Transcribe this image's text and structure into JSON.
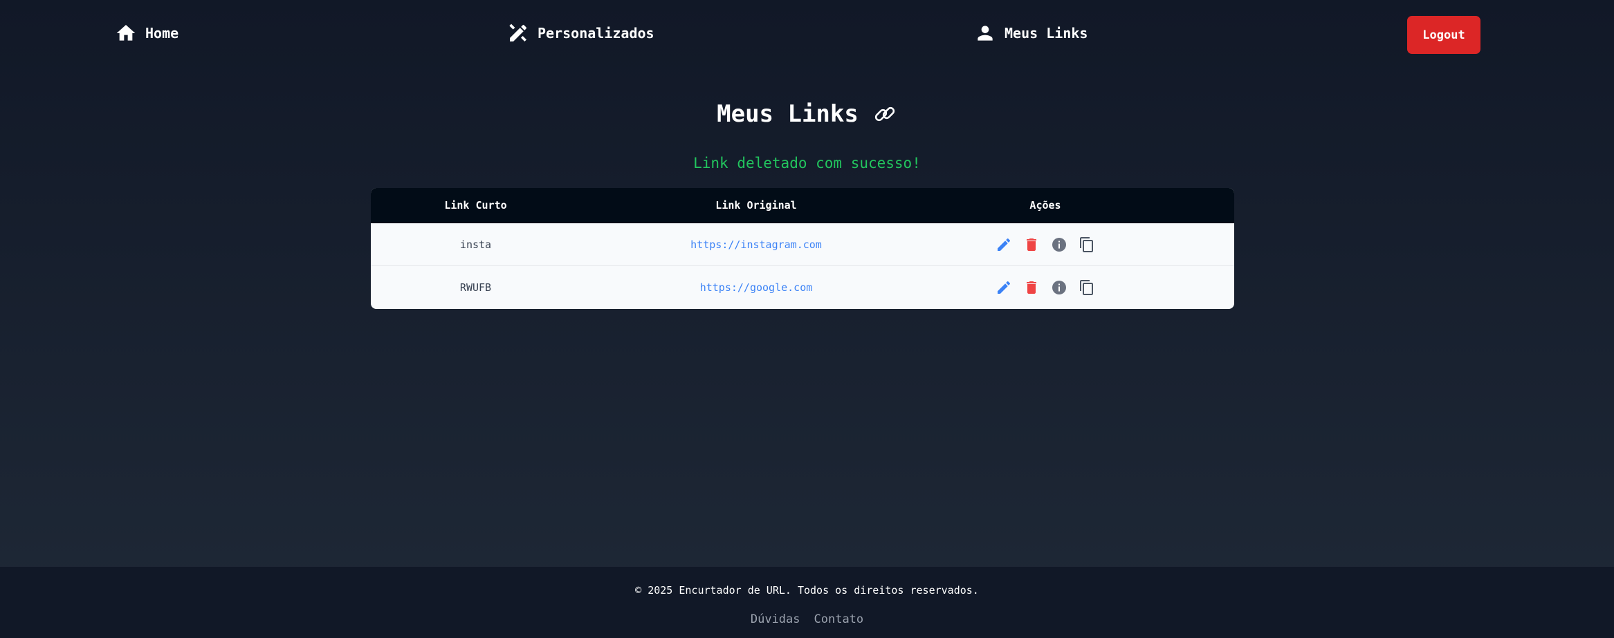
{
  "nav": {
    "home_label": "Home",
    "custom_label": "Personalizados",
    "mylinks_label": "Meus Links",
    "logout_label": "Logout"
  },
  "main": {
    "title": "Meus Links",
    "success_message": "Link deletado com sucesso!"
  },
  "table": {
    "headers": [
      "Link Curto",
      "Link Original",
      "Ações"
    ],
    "rows": [
      {
        "short": "insta",
        "original": "https://instagram.com"
      },
      {
        "short": "RWUFB",
        "original": "https://google.com"
      }
    ],
    "action_icons": [
      "edit-icon",
      "delete-icon",
      "info-icon",
      "copy-icon"
    ]
  },
  "footer": {
    "copyright": "© 2025 Encurtador de URL. Todos os direitos reservados.",
    "links": [
      "Dúvidas",
      "Contato"
    ]
  },
  "colors": {
    "logout": "#dc2626",
    "success": "#22c55e",
    "link": "#3b82f6",
    "edit": "#3b82f6",
    "delete": "#ef4444",
    "info": "#6b7280",
    "copy": "#4b5563"
  }
}
